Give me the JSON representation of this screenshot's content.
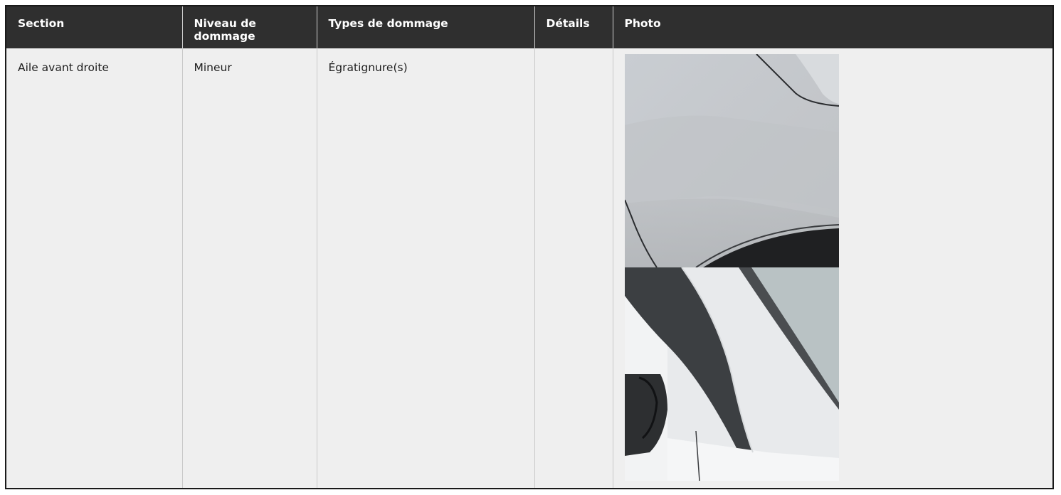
{
  "table": {
    "headers": [
      "Section",
      "Niveau de\ndommage",
      "Types de dommage",
      "Détails",
      "Photo"
    ],
    "rows": [
      {
        "section": "Aile avant droite",
        "niveau": "Mineur",
        "types": "Égratignure(s)",
        "details": "",
        "photos": [
          "fender-scratch-photo",
          "mirror-pillar-photo"
        ]
      }
    ]
  },
  "colors": {
    "header_bg": "#2f2f2f",
    "header_text": "#ffffff",
    "body_bg": "#efefef",
    "frame_border": "#1a1a1a"
  }
}
